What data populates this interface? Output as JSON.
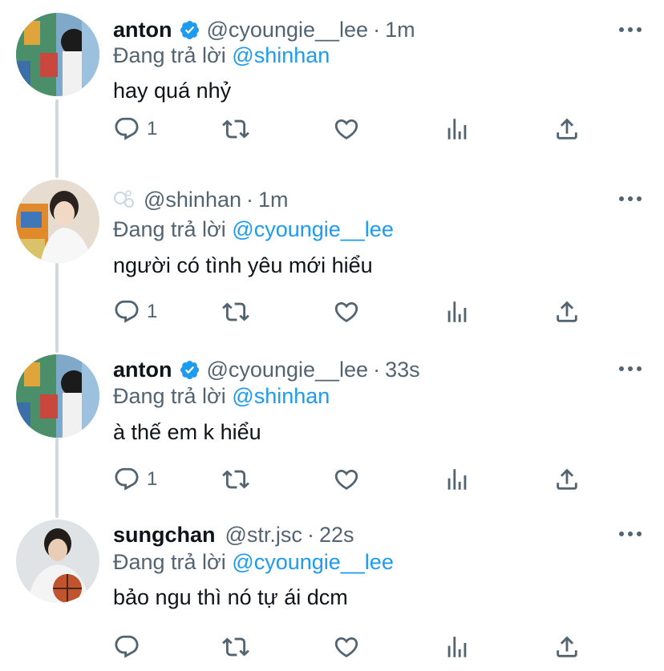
{
  "colors": {
    "accent": "#1d9bf0",
    "muted": "#536471",
    "text": "#0f1419",
    "thread_line": "#cfd9de"
  },
  "tweets": [
    {
      "name": "anton",
      "verified": true,
      "handle": "@cyoungie__lee",
      "dot": "·",
      "time": "1m",
      "reply_prefix": "Đang trả lời",
      "reply_mention": "@shinhan",
      "text": "hay quá nhỷ",
      "reply_count": "1",
      "avatar_icon": "avatar-anton"
    },
    {
      "name": "",
      "verified": false,
      "handle": "@shinhan",
      "dot": "·",
      "time": "1m",
      "reply_prefix": "Đang trả lời",
      "reply_mention": "@cyoungie__lee",
      "text": "người có tình yêu mới hiểu",
      "reply_count": "1",
      "avatar_icon": "avatar-shinhan"
    },
    {
      "name": "anton",
      "verified": true,
      "handle": "@cyoungie__lee",
      "dot": "·",
      "time": "33s",
      "reply_prefix": "Đang trả lời",
      "reply_mention": "@shinhan",
      "text": "à thế em k hiểu",
      "reply_count": "1",
      "avatar_icon": "avatar-anton"
    },
    {
      "name": "sungchan",
      "verified": false,
      "handle": "@str.jsc",
      "dot": "·",
      "time": "22s",
      "reply_prefix": "Đang trả lời",
      "reply_mention": "@cyoungie__lee",
      "text": "bảo ngu thì nó tự ái dcm",
      "reply_count": "",
      "avatar_icon": "avatar-sungchan"
    }
  ]
}
